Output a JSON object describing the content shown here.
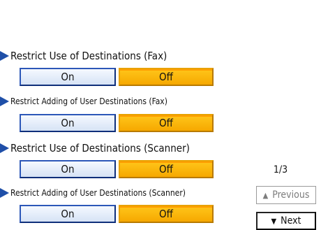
{
  "settings": [
    {
      "label": "Restrict Use of Destinations (Fax)",
      "on": "On",
      "off": "Off",
      "selected": "Off"
    },
    {
      "label": "Restrict Adding of User Destinations (Fax)",
      "on": "On",
      "off": "Off",
      "selected": "Off"
    },
    {
      "label": "Restrict Use of Destinations (Scanner)",
      "on": "On",
      "off": "Off",
      "selected": "Off"
    },
    {
      "label": "Restrict Adding of User Destinations (Scanner)",
      "on": "On",
      "off": "Off",
      "selected": "Off"
    }
  ],
  "pagination": {
    "indicator": "1/3",
    "previous": "Previous",
    "next": "Next"
  },
  "icons": {
    "bullet": "triangle-right-icon",
    "previous": "up-triangle-icon",
    "next": "down-triangle-icon"
  },
  "colors": {
    "accent_blue": "#2c57b8",
    "selected_orange": "#f6a800",
    "bullet_blue": "#1f4fa8"
  }
}
